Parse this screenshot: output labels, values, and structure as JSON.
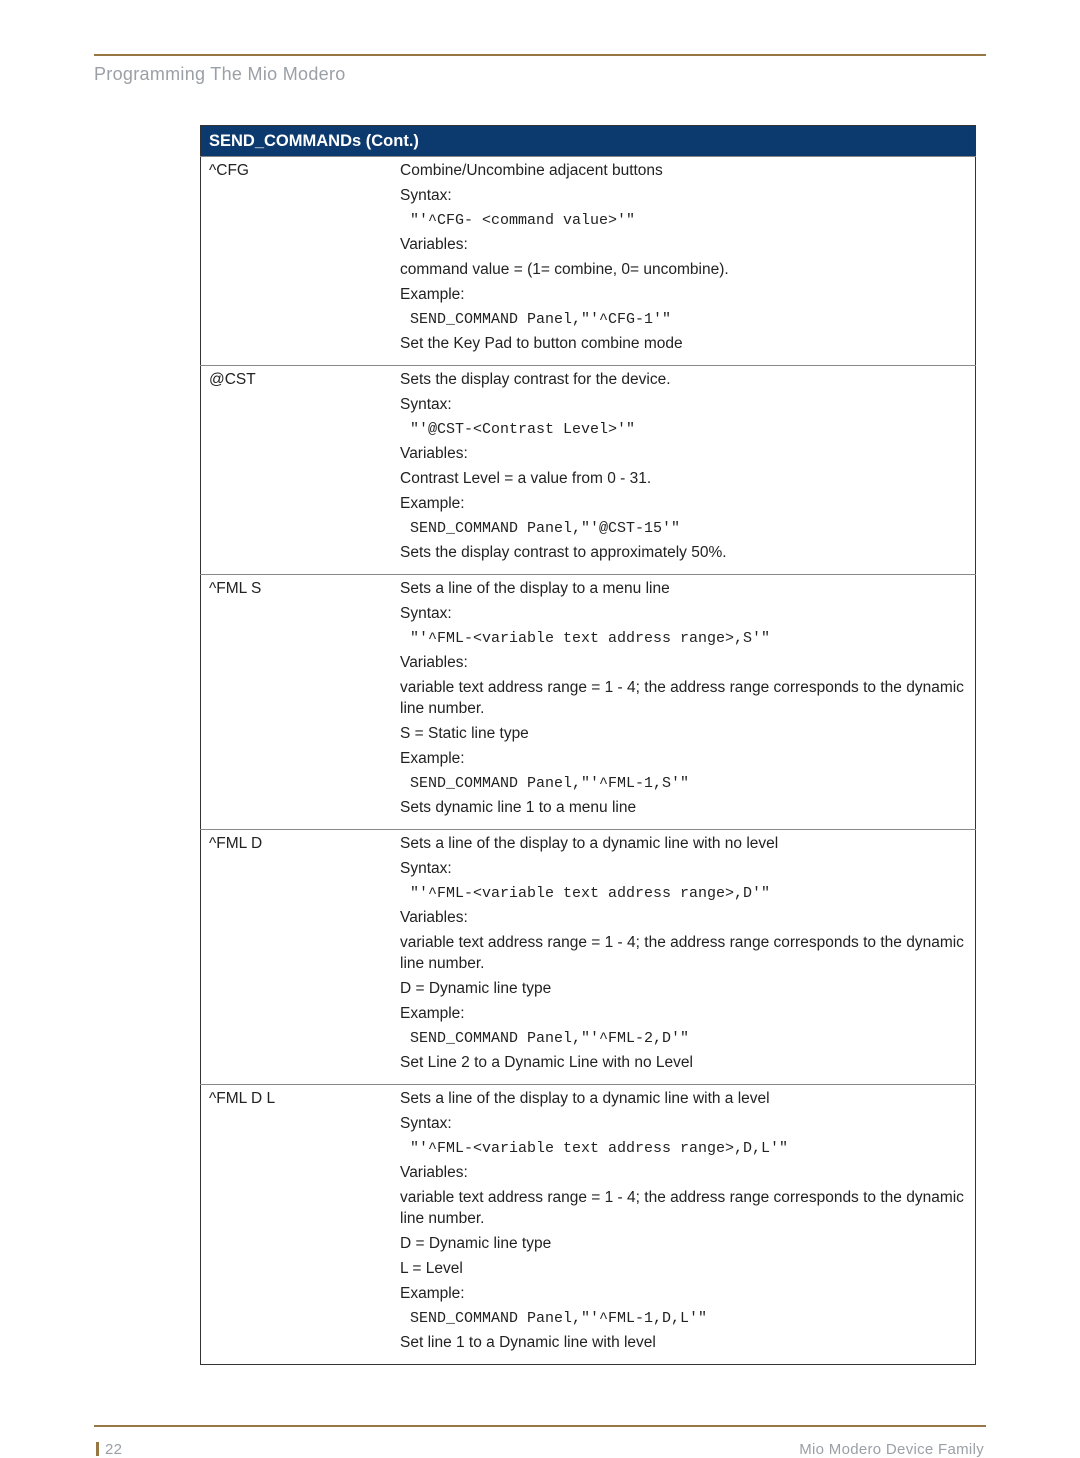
{
  "page": {
    "section_title": "Programming The Mio Modero",
    "footer_left": "22",
    "footer_right": "Mio Modero Device Family"
  },
  "table": {
    "header": "SEND_COMMANDs (Cont.)",
    "rows": [
      {
        "name": "^CFG",
        "lines": [
          {
            "t": "text",
            "v": "Combine/Uncombine adjacent buttons"
          },
          {
            "t": "text",
            "v": "Syntax:"
          },
          {
            "t": "code",
            "v": "\"'^CFG- <command value>'\""
          },
          {
            "t": "text",
            "v": "Variables:"
          },
          {
            "t": "text",
            "v": "command value = (1= combine, 0= uncombine)."
          },
          {
            "t": "text",
            "v": "Example:"
          },
          {
            "t": "code",
            "v": "SEND_COMMAND Panel,\"'^CFG-1'\""
          },
          {
            "t": "text",
            "v": "Set the Key Pad to button combine mode"
          }
        ]
      },
      {
        "name": "@CST",
        "lines": [
          {
            "t": "text",
            "v": "Sets the display contrast for the device."
          },
          {
            "t": "text",
            "v": "Syntax:"
          },
          {
            "t": "code",
            "v": "\"'@CST-<Contrast Level>'\""
          },
          {
            "t": "text",
            "v": "Variables:"
          },
          {
            "t": "text",
            "v": " Contrast Level = a value from 0 - 31."
          },
          {
            "t": "text",
            "v": "Example:"
          },
          {
            "t": "code",
            "v": "SEND_COMMAND Panel,\"'@CST-15'\""
          },
          {
            "t": "text",
            "v": "Sets the display contrast to approximately 50%."
          }
        ]
      },
      {
        "name": "^FML S",
        "lines": [
          {
            "t": "text",
            "v": "Sets a line of the display to a menu line"
          },
          {
            "t": "text",
            "v": "Syntax:"
          },
          {
            "t": "code",
            "v": "\"'^FML-<variable text address range>,S'\""
          },
          {
            "t": "text",
            "v": "Variables:"
          },
          {
            "t": "text",
            "v": "variable text address range = 1 - 4; the address range corresponds to the dynamic line number."
          },
          {
            "t": "text",
            "v": "S = Static line type"
          },
          {
            "t": "text",
            "v": "Example:"
          },
          {
            "t": "code",
            "v": "SEND_COMMAND Panel,\"'^FML-1,S'\""
          },
          {
            "t": "text",
            "v": "Sets dynamic line 1 to a menu line"
          }
        ]
      },
      {
        "name": "^FML D",
        "lines": [
          {
            "t": "text",
            "v": "Sets a line of the display to a dynamic line with no level"
          },
          {
            "t": "text",
            "v": "Syntax:"
          },
          {
            "t": "code",
            "v": "\"'^FML-<variable text address range>,D'\""
          },
          {
            "t": "text",
            "v": "Variables:"
          },
          {
            "t": "text",
            "v": "variable text address range = 1 - 4; the address range corresponds to the dynamic line number."
          },
          {
            "t": "text",
            "v": "D = Dynamic line type"
          },
          {
            "t": "text",
            "v": "Example:"
          },
          {
            "t": "code",
            "v": "SEND_COMMAND Panel,\"'^FML-2,D'\""
          },
          {
            "t": "text",
            "v": "Set Line 2 to a Dynamic Line with no Level"
          }
        ]
      },
      {
        "name": "^FML D L",
        "lines": [
          {
            "t": "text",
            "v": "Sets a line of the display to a dynamic line with a level"
          },
          {
            "t": "text",
            "v": "Syntax:"
          },
          {
            "t": "code",
            "v": "\"'^FML-<variable text address range>,D,L'\""
          },
          {
            "t": "text",
            "v": "Variables:"
          },
          {
            "t": "text",
            "v": "variable text address range = 1 - 4; the address range corresponds to the dynamic line number."
          },
          {
            "t": "text",
            "v": "D = Dynamic line type"
          },
          {
            "t": "text",
            "v": "L = Level"
          },
          {
            "t": "text",
            "v": "Example:"
          },
          {
            "t": "code",
            "v": "SEND_COMMAND Panel,\"'^FML-1,D,L'\""
          },
          {
            "t": "text",
            "v": "Set line 1 to a Dynamic line with level"
          }
        ]
      }
    ]
  }
}
